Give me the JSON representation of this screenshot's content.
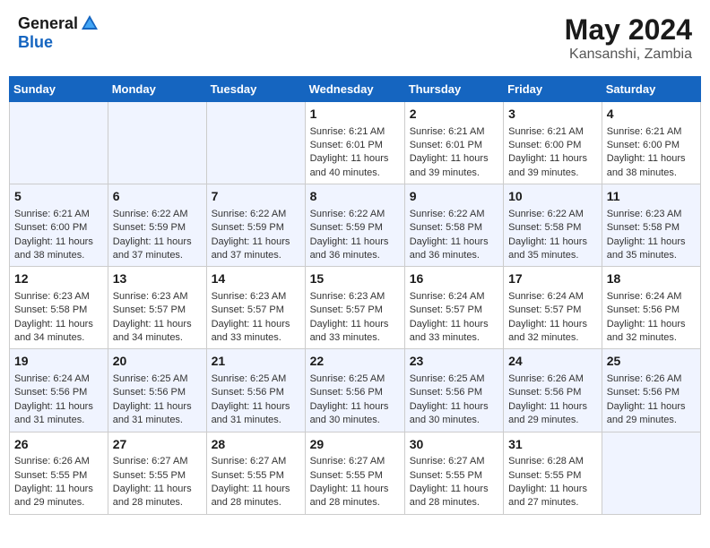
{
  "header": {
    "logo_general": "General",
    "logo_blue": "Blue",
    "month_year": "May 2024",
    "location": "Kansanshi, Zambia"
  },
  "weekdays": [
    "Sunday",
    "Monday",
    "Tuesday",
    "Wednesday",
    "Thursday",
    "Friday",
    "Saturday"
  ],
  "weeks": [
    {
      "days": [
        {
          "num": "",
          "info": ""
        },
        {
          "num": "",
          "info": ""
        },
        {
          "num": "",
          "info": ""
        },
        {
          "num": "1",
          "info": "Sunrise: 6:21 AM\nSunset: 6:01 PM\nDaylight: 11 hours\nand 40 minutes."
        },
        {
          "num": "2",
          "info": "Sunrise: 6:21 AM\nSunset: 6:01 PM\nDaylight: 11 hours\nand 39 minutes."
        },
        {
          "num": "3",
          "info": "Sunrise: 6:21 AM\nSunset: 6:00 PM\nDaylight: 11 hours\nand 39 minutes."
        },
        {
          "num": "4",
          "info": "Sunrise: 6:21 AM\nSunset: 6:00 PM\nDaylight: 11 hours\nand 38 minutes."
        }
      ]
    },
    {
      "days": [
        {
          "num": "5",
          "info": "Sunrise: 6:21 AM\nSunset: 6:00 PM\nDaylight: 11 hours\nand 38 minutes."
        },
        {
          "num": "6",
          "info": "Sunrise: 6:22 AM\nSunset: 5:59 PM\nDaylight: 11 hours\nand 37 minutes."
        },
        {
          "num": "7",
          "info": "Sunrise: 6:22 AM\nSunset: 5:59 PM\nDaylight: 11 hours\nand 37 minutes."
        },
        {
          "num": "8",
          "info": "Sunrise: 6:22 AM\nSunset: 5:59 PM\nDaylight: 11 hours\nand 36 minutes."
        },
        {
          "num": "9",
          "info": "Sunrise: 6:22 AM\nSunset: 5:58 PM\nDaylight: 11 hours\nand 36 minutes."
        },
        {
          "num": "10",
          "info": "Sunrise: 6:22 AM\nSunset: 5:58 PM\nDaylight: 11 hours\nand 35 minutes."
        },
        {
          "num": "11",
          "info": "Sunrise: 6:23 AM\nSunset: 5:58 PM\nDaylight: 11 hours\nand 35 minutes."
        }
      ]
    },
    {
      "days": [
        {
          "num": "12",
          "info": "Sunrise: 6:23 AM\nSunset: 5:58 PM\nDaylight: 11 hours\nand 34 minutes."
        },
        {
          "num": "13",
          "info": "Sunrise: 6:23 AM\nSunset: 5:57 PM\nDaylight: 11 hours\nand 34 minutes."
        },
        {
          "num": "14",
          "info": "Sunrise: 6:23 AM\nSunset: 5:57 PM\nDaylight: 11 hours\nand 33 minutes."
        },
        {
          "num": "15",
          "info": "Sunrise: 6:23 AM\nSunset: 5:57 PM\nDaylight: 11 hours\nand 33 minutes."
        },
        {
          "num": "16",
          "info": "Sunrise: 6:24 AM\nSunset: 5:57 PM\nDaylight: 11 hours\nand 33 minutes."
        },
        {
          "num": "17",
          "info": "Sunrise: 6:24 AM\nSunset: 5:57 PM\nDaylight: 11 hours\nand 32 minutes."
        },
        {
          "num": "18",
          "info": "Sunrise: 6:24 AM\nSunset: 5:56 PM\nDaylight: 11 hours\nand 32 minutes."
        }
      ]
    },
    {
      "days": [
        {
          "num": "19",
          "info": "Sunrise: 6:24 AM\nSunset: 5:56 PM\nDaylight: 11 hours\nand 31 minutes."
        },
        {
          "num": "20",
          "info": "Sunrise: 6:25 AM\nSunset: 5:56 PM\nDaylight: 11 hours\nand 31 minutes."
        },
        {
          "num": "21",
          "info": "Sunrise: 6:25 AM\nSunset: 5:56 PM\nDaylight: 11 hours\nand 31 minutes."
        },
        {
          "num": "22",
          "info": "Sunrise: 6:25 AM\nSunset: 5:56 PM\nDaylight: 11 hours\nand 30 minutes."
        },
        {
          "num": "23",
          "info": "Sunrise: 6:25 AM\nSunset: 5:56 PM\nDaylight: 11 hours\nand 30 minutes."
        },
        {
          "num": "24",
          "info": "Sunrise: 6:26 AM\nSunset: 5:56 PM\nDaylight: 11 hours\nand 29 minutes."
        },
        {
          "num": "25",
          "info": "Sunrise: 6:26 AM\nSunset: 5:56 PM\nDaylight: 11 hours\nand 29 minutes."
        }
      ]
    },
    {
      "days": [
        {
          "num": "26",
          "info": "Sunrise: 6:26 AM\nSunset: 5:55 PM\nDaylight: 11 hours\nand 29 minutes."
        },
        {
          "num": "27",
          "info": "Sunrise: 6:27 AM\nSunset: 5:55 PM\nDaylight: 11 hours\nand 28 minutes."
        },
        {
          "num": "28",
          "info": "Sunrise: 6:27 AM\nSunset: 5:55 PM\nDaylight: 11 hours\nand 28 minutes."
        },
        {
          "num": "29",
          "info": "Sunrise: 6:27 AM\nSunset: 5:55 PM\nDaylight: 11 hours\nand 28 minutes."
        },
        {
          "num": "30",
          "info": "Sunrise: 6:27 AM\nSunset: 5:55 PM\nDaylight: 11 hours\nand 28 minutes."
        },
        {
          "num": "31",
          "info": "Sunrise: 6:28 AM\nSunset: 5:55 PM\nDaylight: 11 hours\nand 27 minutes."
        },
        {
          "num": "",
          "info": ""
        }
      ]
    }
  ]
}
